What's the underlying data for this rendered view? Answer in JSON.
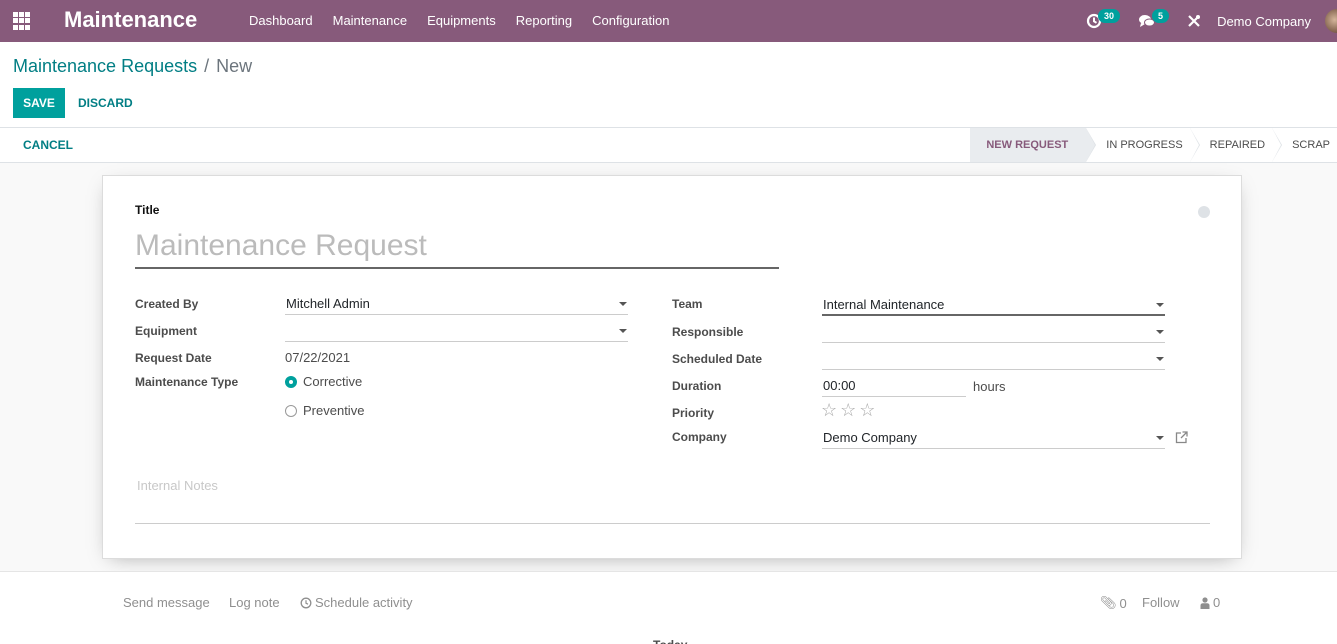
{
  "navbar": {
    "app_title": "Maintenance",
    "menu": [
      "Dashboard",
      "Maintenance",
      "Equipments",
      "Reporting",
      "Configuration"
    ],
    "activity_count": "30",
    "message_count": "5",
    "company": "Demo Company",
    "color": "#875a7b"
  },
  "breadcrumb": {
    "parent": "Maintenance Requests",
    "separator": "/",
    "current": "New"
  },
  "toolbar": {
    "save_label": "SAVE",
    "discard_label": "DISCARD",
    "cancel_label": "CANCEL"
  },
  "stages": [
    {
      "label": "NEW REQUEST",
      "active": true
    },
    {
      "label": "IN PROGRESS",
      "active": false
    },
    {
      "label": "REPAIRED",
      "active": false
    },
    {
      "label": "SCRAP",
      "active": false
    }
  ],
  "form": {
    "title_label": "Title",
    "title_placeholder": "Maintenance Request",
    "left": {
      "created_by_label": "Created By",
      "created_by_value": "Mitchell Admin",
      "equipment_label": "Equipment",
      "equipment_value": "",
      "request_date_label": "Request Date",
      "request_date_value": "07/22/2021",
      "maintenance_type_label": "Maintenance Type",
      "maintenance_type_options": [
        "Corrective",
        "Preventive"
      ],
      "maintenance_type_selected": "Corrective"
    },
    "right": {
      "team_label": "Team",
      "team_value": "Internal Maintenance",
      "responsible_label": "Responsible",
      "responsible_value": "",
      "scheduled_date_label": "Scheduled Date",
      "scheduled_date_value": "",
      "duration_label": "Duration",
      "duration_value": "00:00",
      "duration_unit": "hours",
      "priority_label": "Priority",
      "priority_stars": 0,
      "priority_max": 3,
      "company_label": "Company",
      "company_value": "Demo Company"
    },
    "notes_placeholder": "Internal Notes"
  },
  "chatter": {
    "send_message": "Send message",
    "log_note": "Log note",
    "schedule_activity": "Schedule activity",
    "attachments_count": "0",
    "follow": "Follow",
    "followers_count": "0",
    "today": "Today"
  },
  "colors": {
    "primary": "#00a09d",
    "link": "#017e84"
  }
}
